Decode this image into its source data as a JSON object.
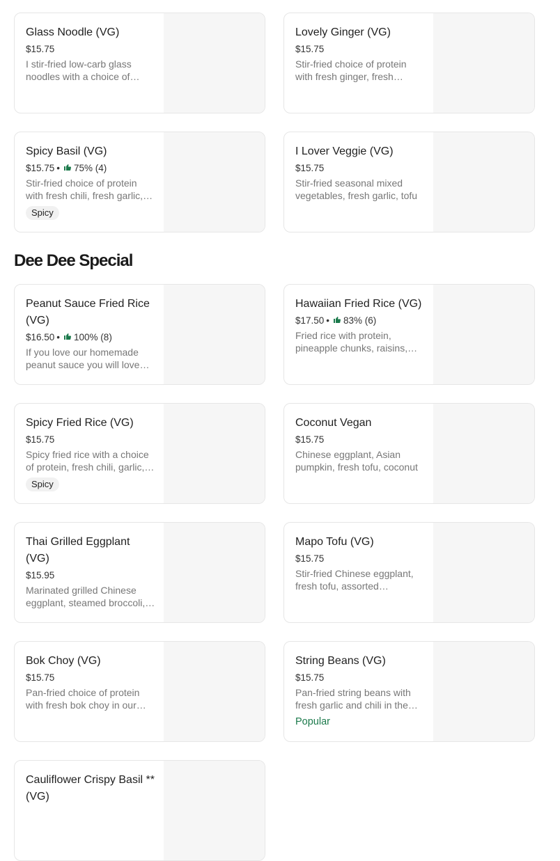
{
  "section": {
    "title": "Dee Dee Special"
  },
  "items": [
    {
      "title": "Glass Noodle (VG)",
      "price": "$15.75",
      "rating": "",
      "desc": "I stir-fried low-carb glass noodles with a choice of protein",
      "badge": "",
      "popular": ""
    },
    {
      "title": "Lovely Ginger (VG)",
      "price": "$15.75",
      "rating": "",
      "desc": "Stir-fried choice of protein with fresh ginger, fresh mushrooms",
      "badge": "",
      "popular": ""
    },
    {
      "title": "Spicy Basil (VG)",
      "price": "$15.75",
      "rating": "75% (4)",
      "desc": "Stir-fried choice of protein with fresh chili, fresh garlic, basil",
      "badge": "Spicy",
      "popular": ""
    },
    {
      "title": "I Lover Veggie (VG)",
      "price": "$15.75",
      "rating": "",
      "desc": "Stir-fried seasonal mixed vegetables, fresh garlic, tofu",
      "badge": "",
      "popular": ""
    },
    {
      "title": "Peanut Sauce Fried Rice (VG)",
      "price": "$16.50",
      "rating": "100% (8)",
      "desc": "If you love our homemade peanut sauce you will love this",
      "badge": "",
      "popular": ""
    },
    {
      "title": "Hawaiian Fried Rice (VG)",
      "price": "$17.50",
      "rating": "83% (6)",
      "desc": "Fried rice with protein, pineapple chunks, raisins, cashew",
      "badge": "",
      "popular": ""
    },
    {
      "title": "Spicy Fried Rice (VG)",
      "price": "$15.75",
      "rating": "",
      "desc": "Spicy fried rice with a choice of protein, fresh chili, garlic, basil",
      "badge": "Spicy",
      "popular": ""
    },
    {
      "title": "Coconut Vegan",
      "price": "$15.75",
      "rating": "",
      "desc": "Chinese eggplant, Asian pumpkin, fresh tofu, coconut",
      "badge": "",
      "popular": ""
    },
    {
      "title": "Thai Grilled Eggplant (VG)",
      "price": "$15.95",
      "rating": "",
      "desc": "Marinated grilled Chinese eggplant, steamed broccoli, sauce",
      "badge": "",
      "popular": ""
    },
    {
      "title": "Mapo Tofu (VG)",
      "price": "$15.75",
      "rating": "",
      "desc": "Stir-fried Chinese eggplant, fresh tofu, assorted vegetables",
      "badge": "",
      "popular": ""
    },
    {
      "title": "Bok Choy (VG)",
      "price": "$15.75",
      "rating": "",
      "desc": "Pan-fried choice of protein with fresh bok choy in our sauce",
      "badge": "",
      "popular": ""
    },
    {
      "title": "String Beans (VG)",
      "price": "$15.75",
      "rating": "",
      "desc": "Pan-fried string beans with fresh garlic and chili in the sauce",
      "badge": "",
      "popular": "Popular"
    },
    {
      "title": "Cauliflower Crispy Basil **(VG)",
      "price": "",
      "rating": "",
      "desc": "",
      "badge": "",
      "popular": ""
    }
  ]
}
